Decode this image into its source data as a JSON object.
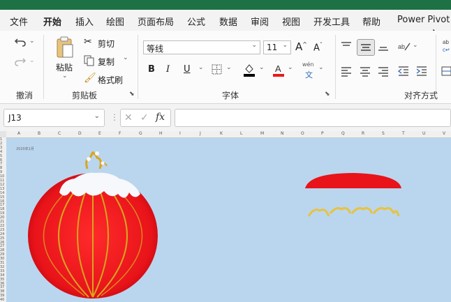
{
  "menubar": {
    "items": [
      "文件",
      "开始",
      "插入",
      "绘图",
      "页面布局",
      "公式",
      "数据",
      "审阅",
      "视图",
      "开发工具",
      "帮助",
      "Power Pivot"
    ],
    "active": "开始"
  },
  "ribbon": {
    "undo_group": {
      "label": "撤消"
    },
    "clipboard": {
      "paste": "粘贴",
      "cut": "剪切",
      "copy": "复制",
      "format_painter": "格式刷",
      "label": "剪贴板"
    },
    "font": {
      "name": "等线",
      "size": "11",
      "label": "字体",
      "bold": "B",
      "italic": "I",
      "underline": "U",
      "phonetic_top": "wén",
      "phonetic_bottom": "文"
    },
    "alignment": {
      "label": "对齐方式"
    }
  },
  "formula_bar": {
    "name_box": "J13",
    "fx": "fx",
    "value": ""
  },
  "sheet": {
    "column_headers": [
      "A",
      "B",
      "C",
      "D",
      "E",
      "F",
      "G",
      "H",
      "I",
      "J",
      "K",
      "L",
      "M",
      "N",
      "O",
      "P",
      "Q",
      "R",
      "S",
      "T",
      "U",
      "V"
    ],
    "row_headers": [
      "1",
      "2",
      "3",
      "4",
      "5",
      "6",
      "7",
      "8",
      "9",
      "10",
      "11",
      "12",
      "13",
      "14",
      "15",
      "16",
      "17",
      "18",
      "19",
      "20",
      "21",
      "22",
      "23",
      "24",
      "25",
      "26",
      "27",
      "28",
      "29",
      "30",
      "31",
      "32",
      "33",
      "34",
      "35",
      "36",
      "37",
      "38",
      "39",
      "40"
    ],
    "cell_note": "2020年1月"
  },
  "colors": {
    "accent": "#1e7145",
    "lantern_red": "#e8141a",
    "lantern_gold": "#d9a520",
    "sheet_bg": "#bad6ee"
  }
}
